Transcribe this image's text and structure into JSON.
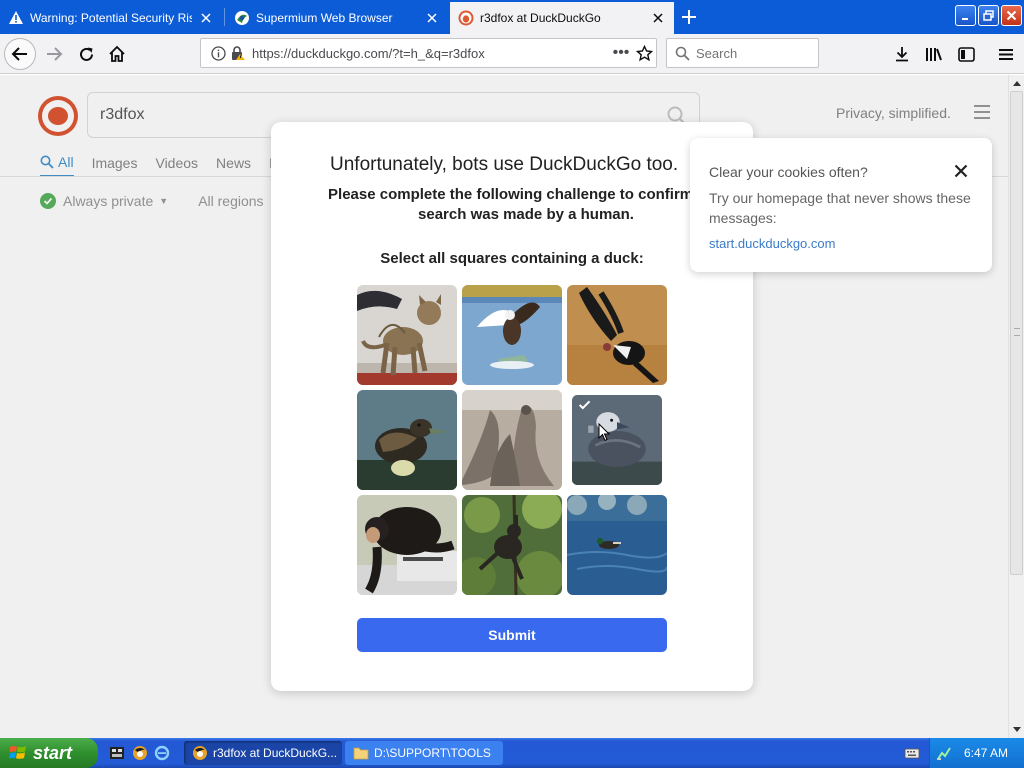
{
  "tabs": [
    {
      "title": "Warning: Potential Security Risk Ah",
      "icon": "warning-icon",
      "active": false
    },
    {
      "title": "Supermium Web Browser",
      "icon": "supermium-icon",
      "active": false
    },
    {
      "title": "r3dfox at DuckDuckGo",
      "icon": "duckduckgo-icon",
      "active": true
    }
  ],
  "nav": {
    "url": "https://duckduckgo.com/?t=h_&q=r3dfox",
    "search_placeholder": "Search"
  },
  "page": {
    "query": "r3dfox",
    "privacy_text": "Privacy, simplified.",
    "tabs": [
      "All",
      "Images",
      "Videos",
      "News",
      "M"
    ],
    "always_private": "Always private",
    "all_regions": "All regions"
  },
  "modal": {
    "title": "Unfortunately, bots use DuckDuckGo too.",
    "subtitle_line1": "Please complete the following challenge to confirm this",
    "subtitle_line2": "search was made by a human.",
    "prompt": "Select all squares containing a duck:",
    "tiles": [
      {
        "subject": "cat",
        "selected": false
      },
      {
        "subject": "eagle catching fish",
        "selected": false
      },
      {
        "subject": "condor",
        "selected": false
      },
      {
        "subject": "duck",
        "selected": false
      },
      {
        "subject": "seals",
        "selected": false
      },
      {
        "subject": "duck",
        "selected": true
      },
      {
        "subject": "chimpanzee",
        "selected": false
      },
      {
        "subject": "monkey",
        "selected": false
      },
      {
        "subject": "duck on water",
        "selected": false
      }
    ],
    "submit_label": "Submit"
  },
  "cookie_popup": {
    "title": "Clear your cookies often?",
    "body": "Try our homepage that never shows these messages:",
    "link": "start.duckduckgo.com"
  },
  "taskbar": {
    "start_label": "start",
    "tasks": [
      {
        "label": "r3dfox at DuckDuckG...",
        "active": true
      },
      {
        "label": "D:\\SUPPORT\\TOOLS",
        "active": false
      }
    ],
    "clock": "6:47 AM"
  },
  "colors": {
    "titlebar": "#0c5cd8",
    "submit": "#3969ef",
    "link": "#3a7bc8",
    "ddg_orange": "#de5833"
  }
}
